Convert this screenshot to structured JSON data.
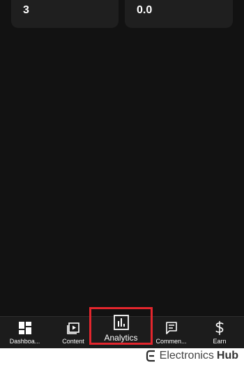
{
  "stats": {
    "left_value": "3",
    "right_value": "0.0"
  },
  "nav": {
    "items": [
      {
        "label": "Dashboa...",
        "icon": "dashboard-icon"
      },
      {
        "label": "Content",
        "icon": "content-icon"
      },
      {
        "label": "Analytics",
        "icon": "analytics-icon",
        "active": true
      },
      {
        "label": "Commen...",
        "icon": "comments-icon"
      },
      {
        "label": "Earn",
        "icon": "dollar-icon"
      }
    ]
  },
  "highlight": {
    "color": "#e3262d"
  },
  "watermark": {
    "brand_light": "Electronics",
    "brand_bold": "Hub"
  }
}
